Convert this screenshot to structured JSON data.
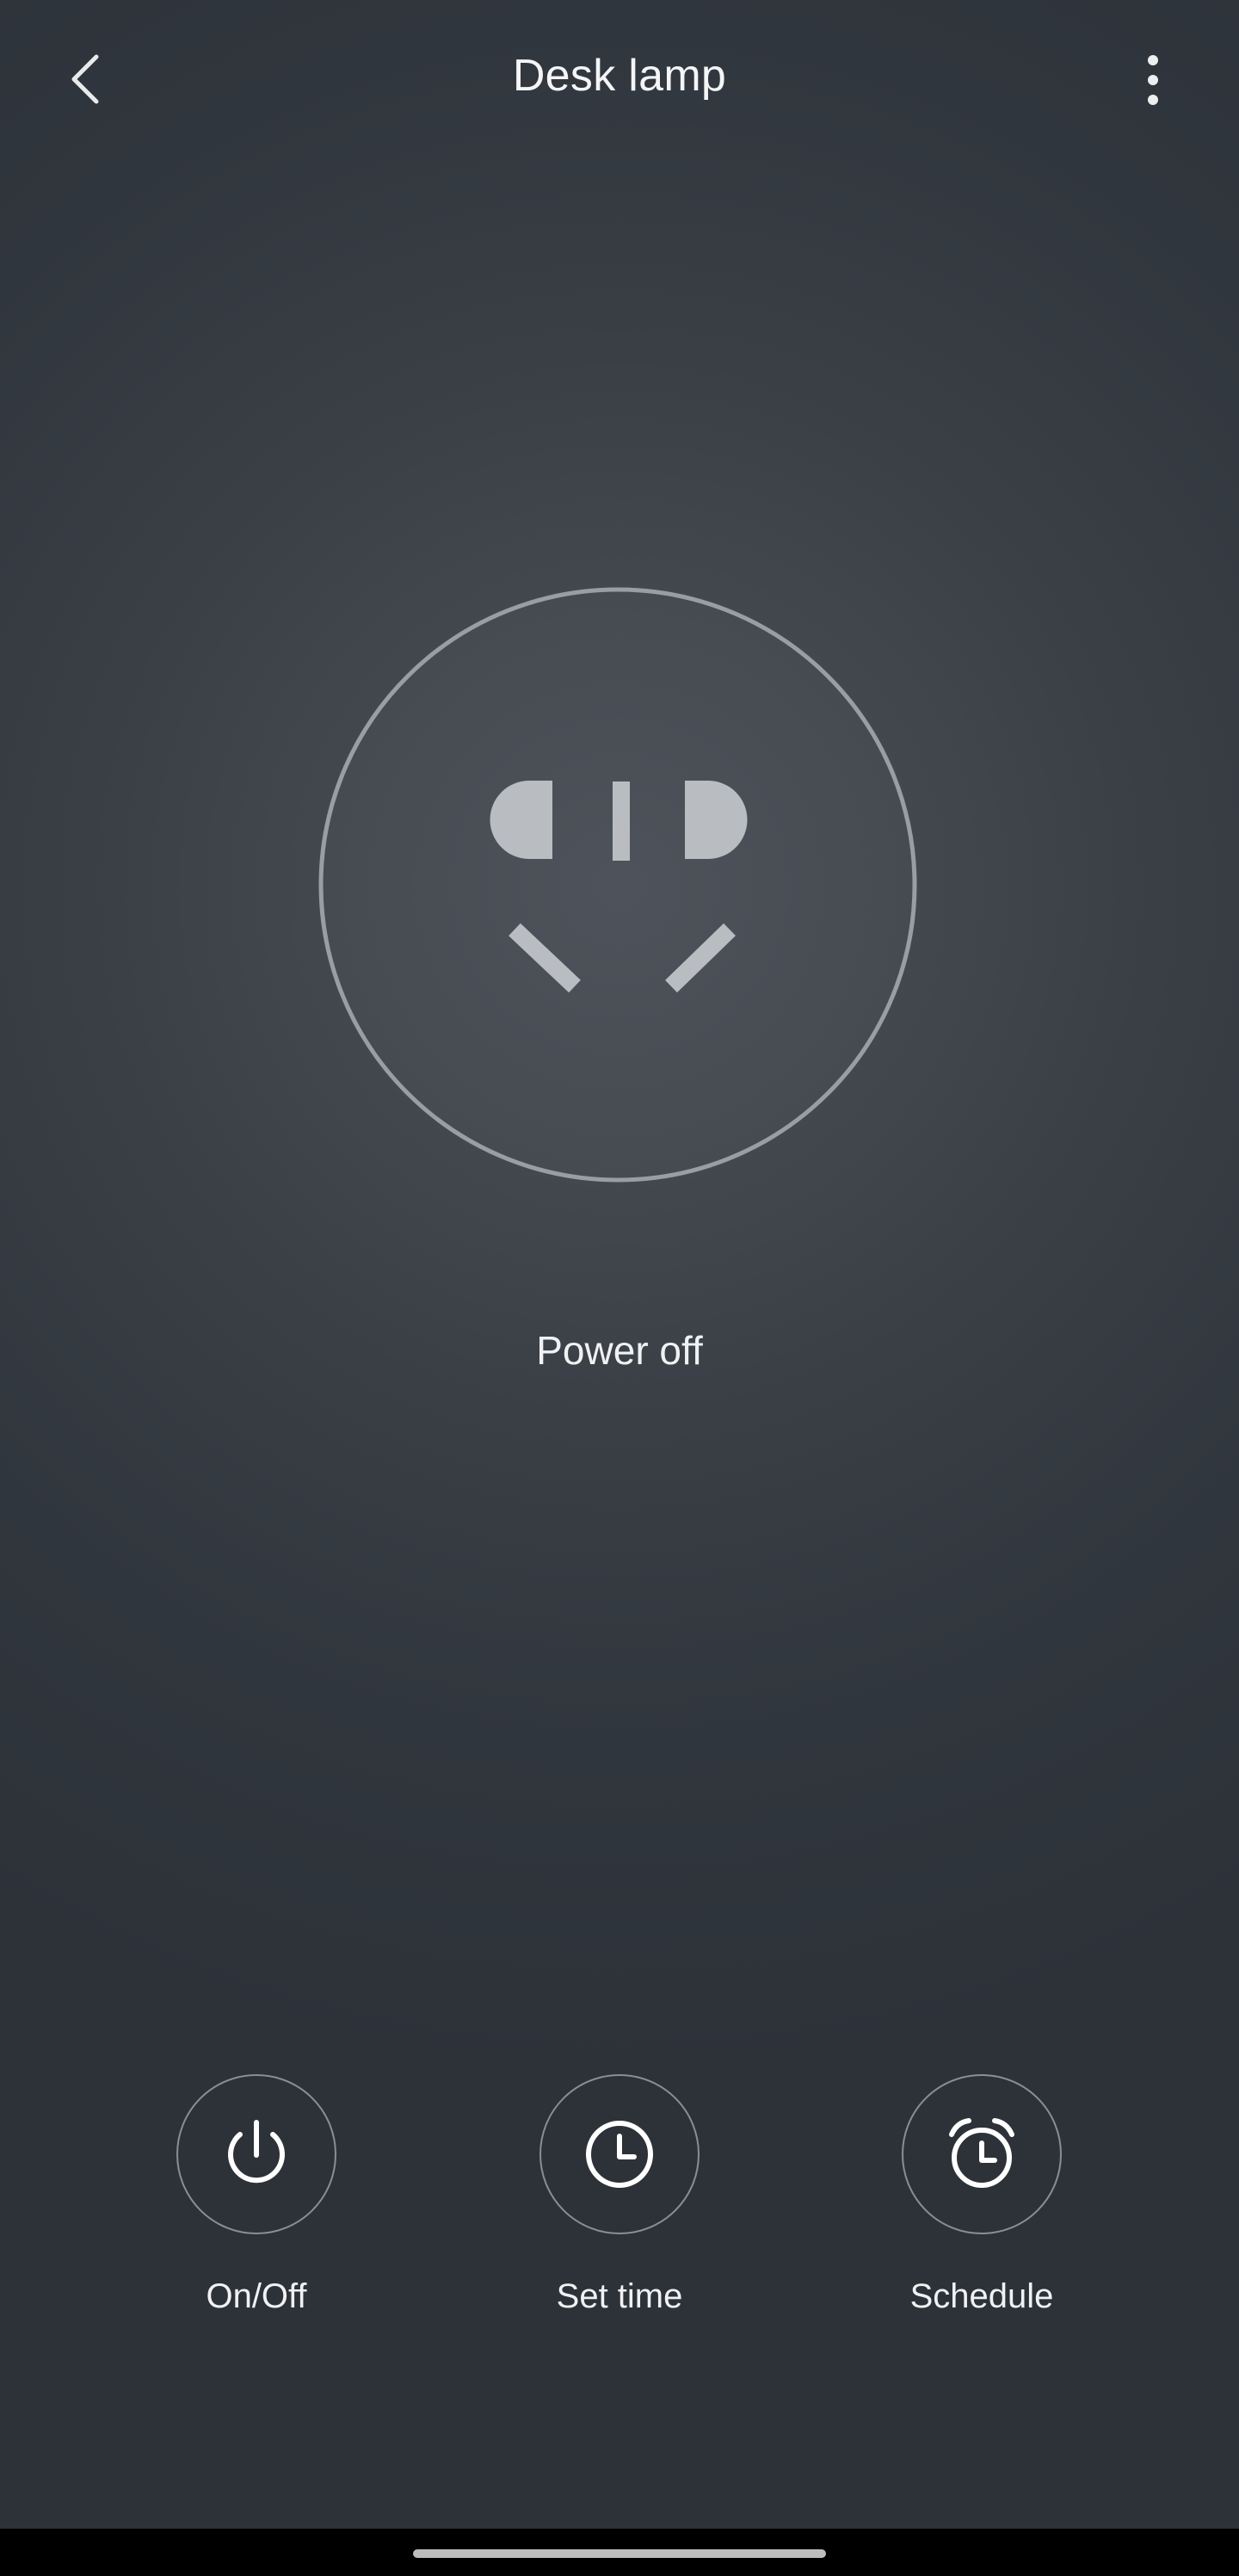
{
  "header": {
    "title": "Desk lamp",
    "back_icon": "chevron-left-icon",
    "more_icon": "more-vertical-icon"
  },
  "device": {
    "icon": "power-socket-icon",
    "status": "Power off"
  },
  "controls": [
    {
      "label": "On/Off",
      "icon": "power-icon"
    },
    {
      "label": "Set time",
      "icon": "clock-icon"
    },
    {
      "label": "Schedule",
      "icon": "alarm-clock-icon"
    }
  ],
  "colors": {
    "background": "#30363d",
    "socket_outline": "#9a9da2",
    "socket_glyph": "#b9bcc1",
    "text": "#ffffff"
  }
}
